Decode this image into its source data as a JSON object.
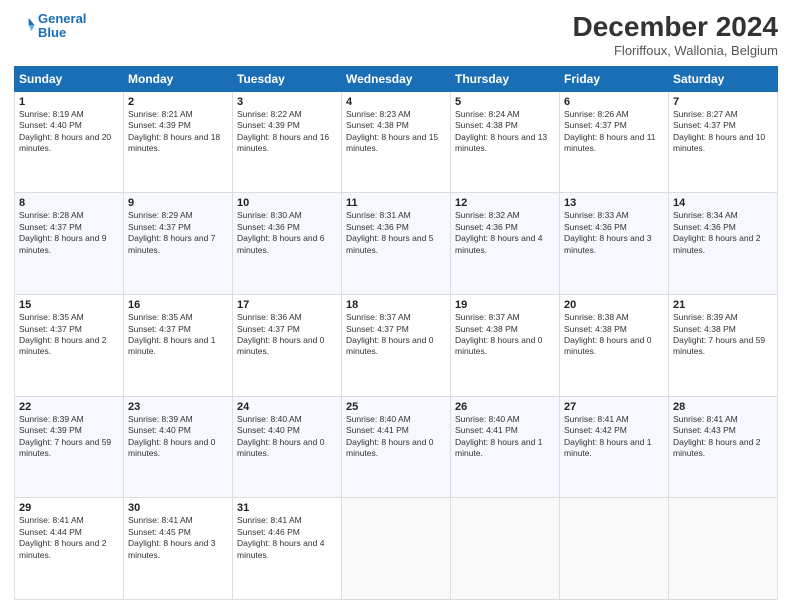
{
  "logo": {
    "line1": "General",
    "line2": "Blue"
  },
  "header": {
    "title": "December 2024",
    "subtitle": "Floriffoux, Wallonia, Belgium"
  },
  "days_of_week": [
    "Sunday",
    "Monday",
    "Tuesday",
    "Wednesday",
    "Thursday",
    "Friday",
    "Saturday"
  ],
  "weeks": [
    [
      {
        "day": "1",
        "sunrise": "8:19 AM",
        "sunset": "4:40 PM",
        "daylight": "8 hours and 20 minutes."
      },
      {
        "day": "2",
        "sunrise": "8:21 AM",
        "sunset": "4:39 PM",
        "daylight": "8 hours and 18 minutes."
      },
      {
        "day": "3",
        "sunrise": "8:22 AM",
        "sunset": "4:39 PM",
        "daylight": "8 hours and 16 minutes."
      },
      {
        "day": "4",
        "sunrise": "8:23 AM",
        "sunset": "4:38 PM",
        "daylight": "8 hours and 15 minutes."
      },
      {
        "day": "5",
        "sunrise": "8:24 AM",
        "sunset": "4:38 PM",
        "daylight": "8 hours and 13 minutes."
      },
      {
        "day": "6",
        "sunrise": "8:26 AM",
        "sunset": "4:37 PM",
        "daylight": "8 hours and 11 minutes."
      },
      {
        "day": "7",
        "sunrise": "8:27 AM",
        "sunset": "4:37 PM",
        "daylight": "8 hours and 10 minutes."
      }
    ],
    [
      {
        "day": "8",
        "sunrise": "8:28 AM",
        "sunset": "4:37 PM",
        "daylight": "8 hours and 9 minutes."
      },
      {
        "day": "9",
        "sunrise": "8:29 AM",
        "sunset": "4:37 PM",
        "daylight": "8 hours and 7 minutes."
      },
      {
        "day": "10",
        "sunrise": "8:30 AM",
        "sunset": "4:36 PM",
        "daylight": "8 hours and 6 minutes."
      },
      {
        "day": "11",
        "sunrise": "8:31 AM",
        "sunset": "4:36 PM",
        "daylight": "8 hours and 5 minutes."
      },
      {
        "day": "12",
        "sunrise": "8:32 AM",
        "sunset": "4:36 PM",
        "daylight": "8 hours and 4 minutes."
      },
      {
        "day": "13",
        "sunrise": "8:33 AM",
        "sunset": "4:36 PM",
        "daylight": "8 hours and 3 minutes."
      },
      {
        "day": "14",
        "sunrise": "8:34 AM",
        "sunset": "4:36 PM",
        "daylight": "8 hours and 2 minutes."
      }
    ],
    [
      {
        "day": "15",
        "sunrise": "8:35 AM",
        "sunset": "4:37 PM",
        "daylight": "8 hours and 2 minutes."
      },
      {
        "day": "16",
        "sunrise": "8:35 AM",
        "sunset": "4:37 PM",
        "daylight": "8 hours and 1 minute."
      },
      {
        "day": "17",
        "sunrise": "8:36 AM",
        "sunset": "4:37 PM",
        "daylight": "8 hours and 0 minutes."
      },
      {
        "day": "18",
        "sunrise": "8:37 AM",
        "sunset": "4:37 PM",
        "daylight": "8 hours and 0 minutes."
      },
      {
        "day": "19",
        "sunrise": "8:37 AM",
        "sunset": "4:38 PM",
        "daylight": "8 hours and 0 minutes."
      },
      {
        "day": "20",
        "sunrise": "8:38 AM",
        "sunset": "4:38 PM",
        "daylight": "8 hours and 0 minutes."
      },
      {
        "day": "21",
        "sunrise": "8:39 AM",
        "sunset": "4:38 PM",
        "daylight": "7 hours and 59 minutes."
      }
    ],
    [
      {
        "day": "22",
        "sunrise": "8:39 AM",
        "sunset": "4:39 PM",
        "daylight": "7 hours and 59 minutes."
      },
      {
        "day": "23",
        "sunrise": "8:39 AM",
        "sunset": "4:40 PM",
        "daylight": "8 hours and 0 minutes."
      },
      {
        "day": "24",
        "sunrise": "8:40 AM",
        "sunset": "4:40 PM",
        "daylight": "8 hours and 0 minutes."
      },
      {
        "day": "25",
        "sunrise": "8:40 AM",
        "sunset": "4:41 PM",
        "daylight": "8 hours and 0 minutes."
      },
      {
        "day": "26",
        "sunrise": "8:40 AM",
        "sunset": "4:41 PM",
        "daylight": "8 hours and 1 minute."
      },
      {
        "day": "27",
        "sunrise": "8:41 AM",
        "sunset": "4:42 PM",
        "daylight": "8 hours and 1 minute."
      },
      {
        "day": "28",
        "sunrise": "8:41 AM",
        "sunset": "4:43 PM",
        "daylight": "8 hours and 2 minutes."
      }
    ],
    [
      {
        "day": "29",
        "sunrise": "8:41 AM",
        "sunset": "4:44 PM",
        "daylight": "8 hours and 2 minutes."
      },
      {
        "day": "30",
        "sunrise": "8:41 AM",
        "sunset": "4:45 PM",
        "daylight": "8 hours and 3 minutes."
      },
      {
        "day": "31",
        "sunrise": "8:41 AM",
        "sunset": "4:46 PM",
        "daylight": "8 hours and 4 minutes."
      },
      null,
      null,
      null,
      null
    ]
  ]
}
